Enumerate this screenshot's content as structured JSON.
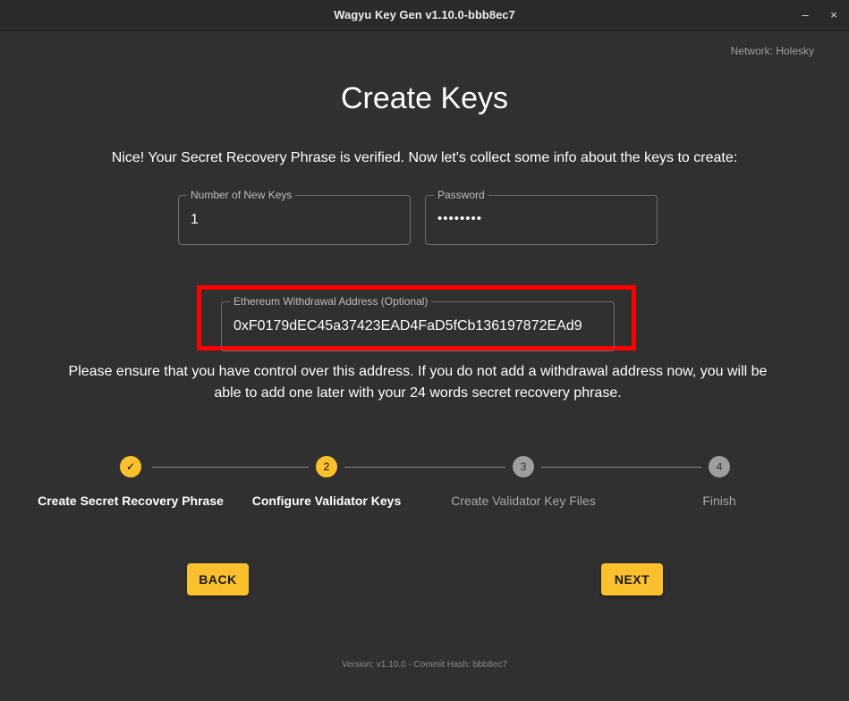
{
  "window": {
    "title": "Wagyu Key Gen v1.10.0-bbb8ec7",
    "minimize_glyph": "–",
    "close_glyph": "×"
  },
  "network_label": "Network: Holesky",
  "heading": "Create Keys",
  "intro": "Nice! Your Secret Recovery Phrase is verified. Now let's collect some info about the keys to create:",
  "fields": {
    "num_keys": {
      "label": "Number of New Keys",
      "value": "1"
    },
    "password": {
      "label": "Password",
      "value": "••••••••"
    },
    "withdrawal": {
      "label": "Ethereum Withdrawal Address (Optional)",
      "value": "0xF0179dEC45a37423EAD4FaD5fCb136197872EAd9"
    }
  },
  "note": "Please ensure that you have control over this address. If you do not add a withdrawal address now, you will be able to add one later with your 24 words secret recovery phrase.",
  "steps": [
    {
      "number": "✓",
      "label": "Create Secret Recovery Phrase",
      "state": "done"
    },
    {
      "number": "2",
      "label": "Configure Validator Keys",
      "state": "active"
    },
    {
      "number": "3",
      "label": "Create Validator Key Files",
      "state": "todo"
    },
    {
      "number": "4",
      "label": "Finish",
      "state": "todo"
    }
  ],
  "buttons": {
    "back": "BACK",
    "next": "NEXT"
  },
  "version": "Version: v1.10.0 - Commit Hash: bbb8ec7",
  "colors": {
    "accent": "#fbc02d",
    "highlight": "#ff0000",
    "background": "#303030"
  }
}
